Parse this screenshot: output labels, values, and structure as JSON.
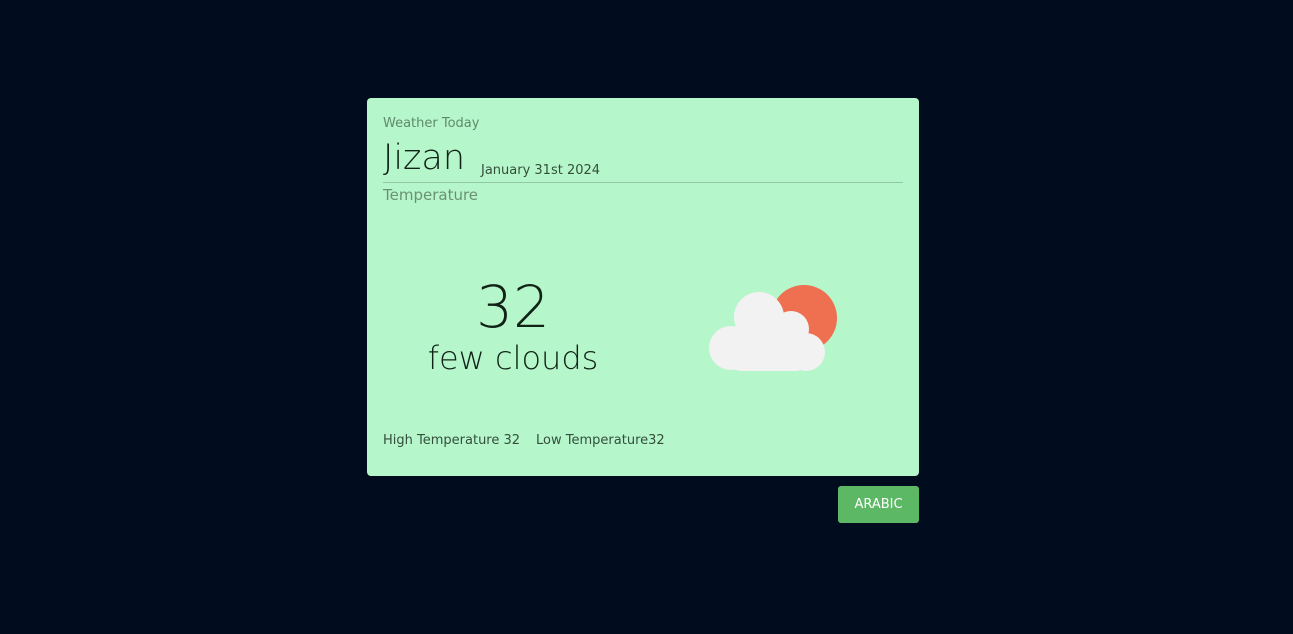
{
  "card": {
    "subtitle": "Weather Today",
    "city": "Jizan",
    "date": "January 31st 2024",
    "temperature_label": "Temperature",
    "temperature": "32",
    "condition": "few clouds",
    "weather_icon": "partly-cloudy-icon",
    "high_temperature": "High Temperature 32",
    "low_temperature": "Low Temperature32"
  },
  "language_button": {
    "label": "ARABIC"
  },
  "colors": {
    "background": "#010c1e",
    "card": "#b6f6cb",
    "button": "#5cb865",
    "sun": "#ee7050",
    "cloud": "#f2f2f2"
  }
}
